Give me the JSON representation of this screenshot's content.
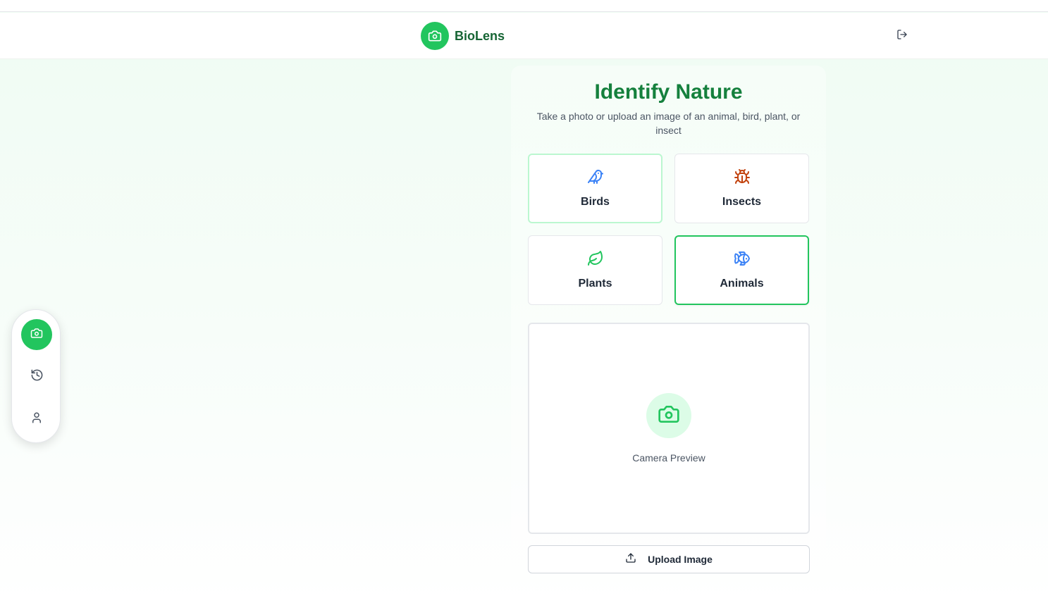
{
  "app": {
    "name": "BioLens",
    "brand_color": "#22c55e",
    "brand_text_color": "#166534"
  },
  "header": {
    "logo_icon": "camera-icon",
    "logout_icon": "logout-icon"
  },
  "side_nav": {
    "items": [
      {
        "name": "camera",
        "icon": "camera-icon",
        "active": true
      },
      {
        "name": "history",
        "icon": "history-icon",
        "active": false
      },
      {
        "name": "profile",
        "icon": "user-icon",
        "active": false
      }
    ]
  },
  "main": {
    "title": "Identify Nature",
    "subtitle": "Take a photo or upload an image of an animal, bird, plant, or insect",
    "categories": [
      {
        "label": "Birds",
        "icon": "bird-icon",
        "color": "#3b82f6",
        "state": "hover"
      },
      {
        "label": "Insects",
        "icon": "bug-icon",
        "color": "#c2410c",
        "state": "default"
      },
      {
        "label": "Plants",
        "icon": "leaf-icon",
        "color": "#22c55e",
        "state": "default"
      },
      {
        "label": "Animals",
        "icon": "fish-icon",
        "color": "#3b82f6",
        "state": "selected"
      }
    ],
    "preview": {
      "label": "Camera Preview",
      "icon": "camera-icon"
    },
    "upload": {
      "label": "Upload Image",
      "icon": "upload-icon"
    }
  }
}
